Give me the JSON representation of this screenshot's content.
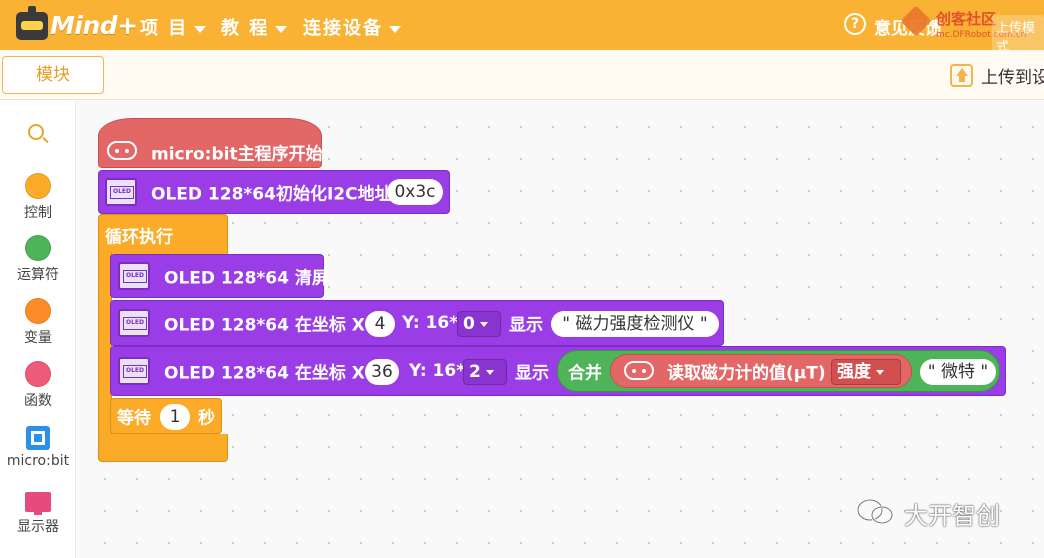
{
  "app": {
    "logo_text": "Mind+"
  },
  "menu": [
    {
      "label": "项 目"
    },
    {
      "label": "教 程"
    },
    {
      "label": "连接设备"
    }
  ],
  "header_right": {
    "help_label": "意见反馈",
    "brand_title": "创客社区",
    "brand_sub": "mc.DFRobot.com.cn",
    "mode_label": "上传模式"
  },
  "toolbar": {
    "module_tab": "模块",
    "upload_label": "上传到设备"
  },
  "categories": [
    {
      "label": "控制",
      "color": "#fbab28"
    },
    {
      "label": "运算符",
      "color": "#4fb35a"
    },
    {
      "label": "变量",
      "color": "#fb8c28"
    },
    {
      "label": "函数",
      "color": "#ee5a7a"
    },
    {
      "label": "micro:bit",
      "icon": "chip-icon"
    },
    {
      "label": "显示器",
      "icon": "screen-icon"
    }
  ],
  "blocks": {
    "hat": {
      "label": "micro:bit主程序开始"
    },
    "init": {
      "label": "OLED 128*64初始化I2C地址",
      "address": "0x3c"
    },
    "loop": {
      "label": "循环执行"
    },
    "clear": {
      "label": "OLED 128*64 清屏"
    },
    "show1": {
      "label": "OLED 128*64 在坐标 X:",
      "x": "4",
      "y_label": "Y: 16*",
      "y": "0",
      "show_label": "显示",
      "text": "\" 磁力强度检测仪 \""
    },
    "show2": {
      "label": "OLED 128*64 在坐标 X:",
      "x": "36",
      "y_label": "Y: 16*",
      "y": "2",
      "show_label": "显示",
      "join_label": "合并",
      "read_label": "读取磁力计的值(μT)",
      "read_option": "强度",
      "text": "\" 微特 \""
    },
    "wait": {
      "label": "等待",
      "seconds": "1",
      "unit": "秒"
    }
  },
  "watermark": {
    "text": "大开智创"
  }
}
